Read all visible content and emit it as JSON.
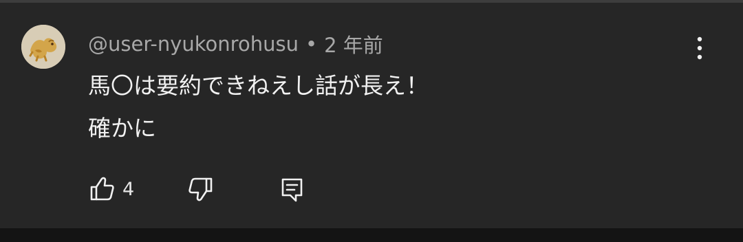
{
  "comment": {
    "author": "@user-nyukonrohusu",
    "separator": "•",
    "timestamp": "2 年前",
    "lines": [
      "馬〇は要約できねえし話が長え！",
      "確かに"
    ],
    "like_count": "4"
  },
  "icons": {
    "like": "thumbs-up-icon",
    "dislike": "thumbs-down-icon",
    "reply": "reply-comment-icon",
    "more": "vertical-more-icon"
  },
  "colors": {
    "background": "#262626",
    "author_text": "#a8a8a8",
    "comment_text": "#f1f1f1"
  }
}
